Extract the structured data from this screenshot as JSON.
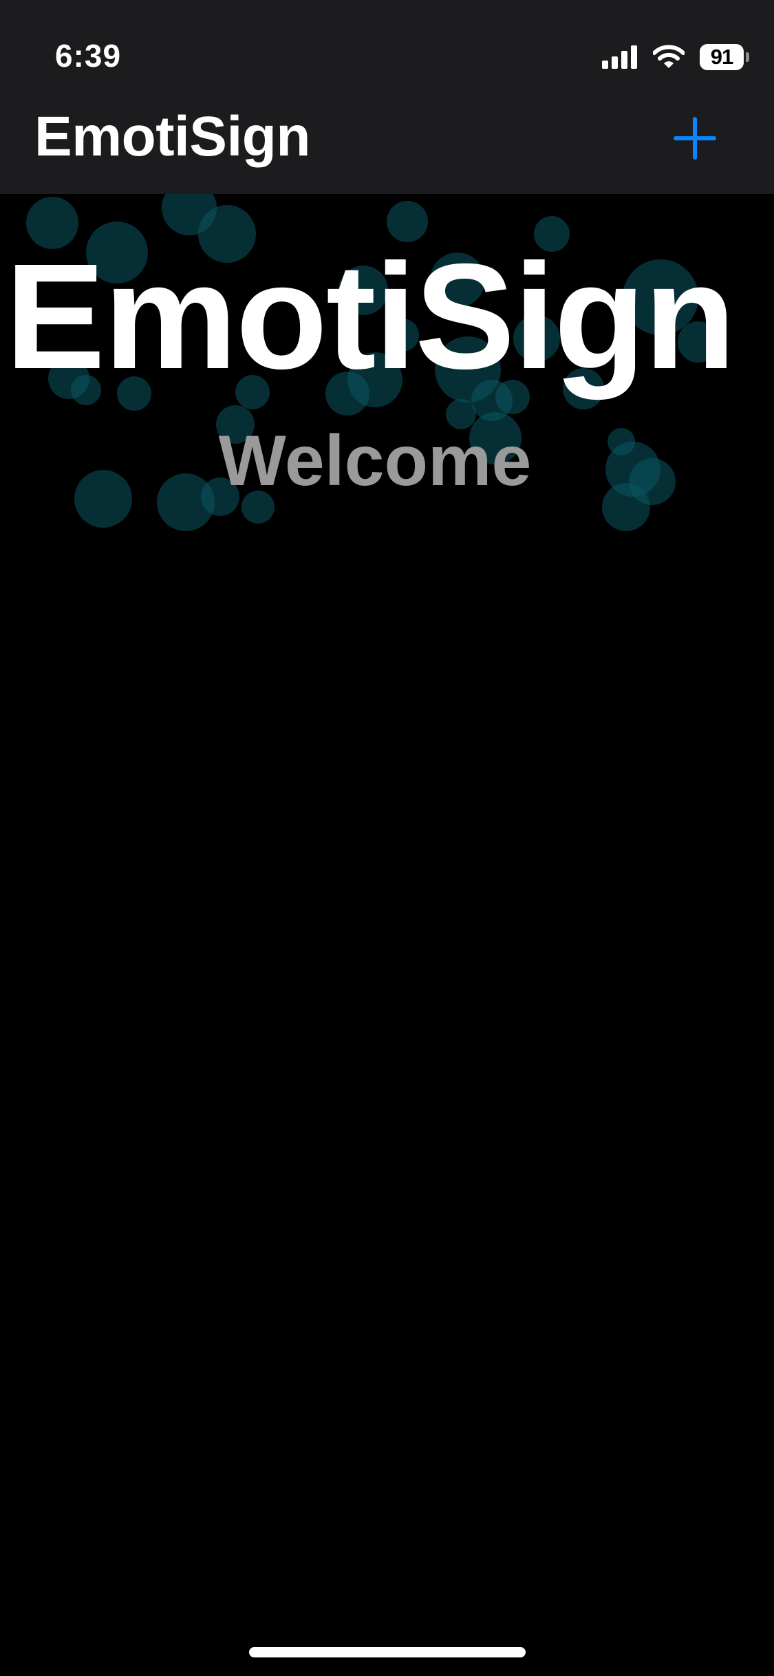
{
  "status_bar": {
    "time": "6:39",
    "battery_level": "91",
    "icons": [
      "signal-icon",
      "wifi-icon",
      "battery-icon"
    ]
  },
  "nav_bar": {
    "title": "EmotiSign",
    "add_button_icon": "plus-icon"
  },
  "hero": {
    "title": "EmotiSign",
    "subtitle": "Welcome"
  },
  "colors": {
    "background": "#000000",
    "nav_background": "#1c1c1e",
    "accent": "#0a84ff",
    "bubbles": "#0b4f59",
    "subtitle": "#9a9a9a"
  }
}
